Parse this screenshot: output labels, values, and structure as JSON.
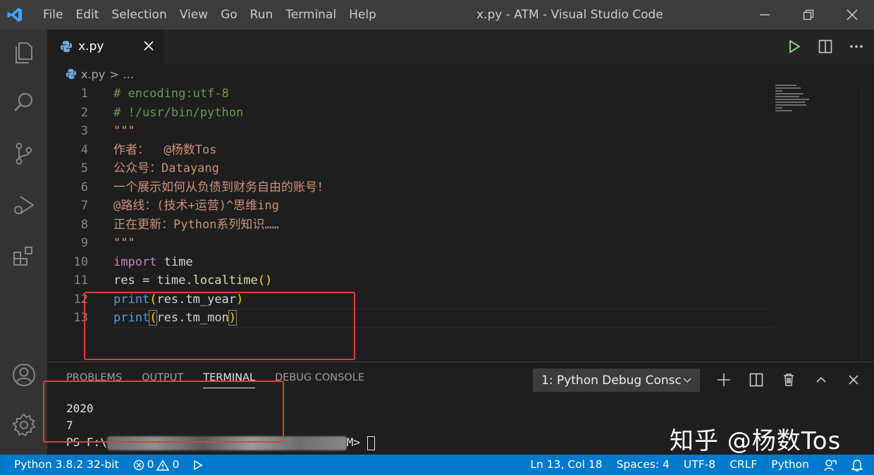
{
  "titlebar": {
    "menu": [
      "File",
      "Edit",
      "Selection",
      "View",
      "Go",
      "Run",
      "Terminal",
      "Help"
    ],
    "window_title": "x.py - ATM - Visual Studio Code"
  },
  "tab": {
    "label": "x.py"
  },
  "breadcrumb": {
    "file": "x.py",
    "sep": ">",
    "more": "..."
  },
  "editor": {
    "lines": [
      {
        "n": "1",
        "t": "# encoding:utf-8"
      },
      {
        "n": "2",
        "t": "# !/usr/bin/python"
      },
      {
        "n": "3",
        "t": "\"\"\""
      },
      {
        "n": "4",
        "t": "作者：  @杨数Tos"
      },
      {
        "n": "5",
        "t": "公众号：Datayang"
      },
      {
        "n": "6",
        "t": "一个展示如何从负债到财务自由的账号！"
      },
      {
        "n": "7",
        "t": "@路线：(技术+运营)^思维ing"
      },
      {
        "n": "8",
        "t": "正在更新：Python系列知识……"
      },
      {
        "n": "9",
        "t": "\"\"\""
      },
      {
        "n": "10",
        "kw": "import",
        "rest": " time"
      },
      {
        "n": "11",
        "v": "res = time.",
        "call": "localtime",
        "p": "()"
      },
      {
        "n": "12",
        "fn": "print",
        "p1": "(",
        "arg": "res.tm_year",
        "p2": ")"
      },
      {
        "n": "13",
        "fn": "print",
        "p1": "(",
        "arg": "res.tm_mon",
        "p2": ")"
      }
    ]
  },
  "panel": {
    "tabs": [
      "PROBLEMS",
      "OUTPUT",
      "TERMINAL",
      "DEBUG CONSOLE"
    ],
    "active_tab": "TERMINAL",
    "terminal_select": "1: Python Debug Consc",
    "terminal_lines": [
      "2020",
      "7"
    ],
    "prompt_start": "PS F:\\",
    "prompt_end": "M> "
  },
  "watermark": "知乎 @杨数Tos",
  "statusbar": {
    "interpreter": "Python 3.8.2 32-bit",
    "errors": "0",
    "warnings": "0",
    "position": "Ln 13, Col 18",
    "spaces": "Spaces: 4",
    "encoding": "UTF-8",
    "eol": "CRLF",
    "language": "Python"
  },
  "colors": {
    "statusbar": "#007acc",
    "accent_red": "#e33b3b",
    "run_green": "#89d185"
  }
}
